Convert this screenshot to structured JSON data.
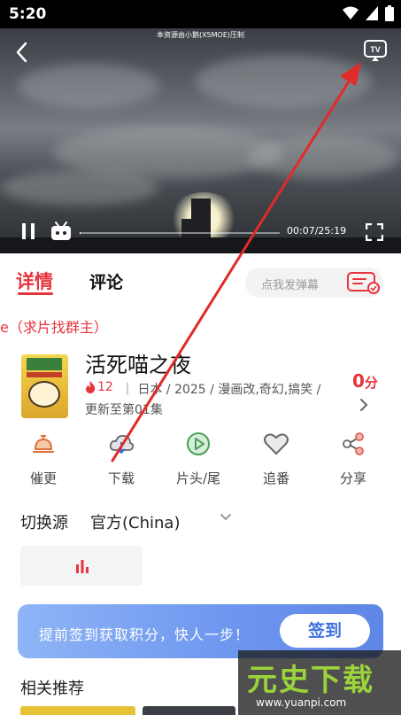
{
  "status_bar": {
    "time": "5:20"
  },
  "player": {
    "watermark": "本资源由小鹅(X5MOE)压制",
    "current_time": "00:07",
    "duration": "25:19",
    "time_display": "00:07/25:19",
    "progress_fraction": 0.005
  },
  "tabs": {
    "detail": "详情",
    "comments": "评论"
  },
  "danmaku": {
    "placeholder": "点我发弹幕"
  },
  "notice": "e（求片找群主）",
  "show": {
    "title": "活死喵之夜",
    "heat": "12",
    "meta_line": "｜ 日本 / 2025 / 漫画改,奇幻,搞笑 /",
    "update": "更新至第01集",
    "score_value": "0",
    "score_unit": "分"
  },
  "actions": [
    {
      "label": "催更",
      "icon": "bell-icon"
    },
    {
      "label": "下载",
      "icon": "cloud-download-icon"
    },
    {
      "label": "片头/尾",
      "icon": "play-circle-icon"
    },
    {
      "label": "追番",
      "icon": "heart-icon"
    },
    {
      "label": "分享",
      "icon": "share-icon"
    }
  ],
  "source": {
    "label": "切换源",
    "value": "官方(China)"
  },
  "banner": {
    "text": "提前签到获取积分，快人一步！",
    "button": "签到"
  },
  "recommend": {
    "title": "相关推荐"
  },
  "site_watermark": {
    "name": "元史下载",
    "url": "www.yuanpi.com"
  },
  "colors": {
    "accent": "#e8343c",
    "banner_start": "#8fb4f6",
    "banner_end": "#5d86e6"
  }
}
